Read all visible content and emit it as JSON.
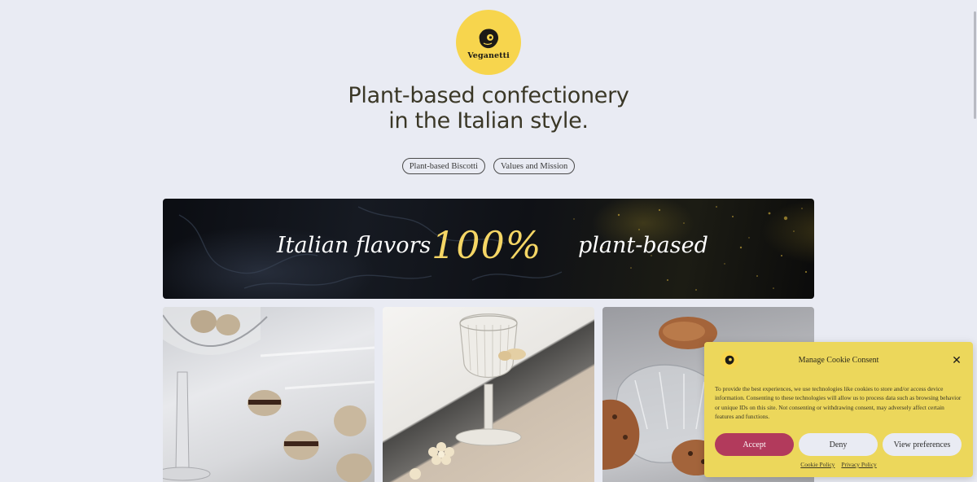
{
  "brand": {
    "name": "Veganetti",
    "accent": "#f7d54d"
  },
  "hero": {
    "headline_line1": "Plant-based confectionery",
    "headline_line2": "in the Italian style."
  },
  "nav": {
    "pills": [
      {
        "label": "Plant-based Biscotti"
      },
      {
        "label": "Values and Mission"
      }
    ]
  },
  "banner": {
    "left_text": "Italian flavors",
    "center_text": "100%",
    "right_text": "plant-based",
    "highlight_color": "#f5d665"
  },
  "gallery": {
    "photos": [
      {
        "name": "baci-biscotti-glass"
      },
      {
        "name": "ribbed-glass-cookies"
      },
      {
        "name": "biscotti-glass-dish"
      }
    ]
  },
  "cookie_banner": {
    "title": "Manage Cookie Consent",
    "close_icon": "close-icon",
    "body": "To provide the best experiences, we use technologies like cookies to store and/or access device information. Consenting to these technologies will allow us to process data such as browsing behavior or unique IDs on this site. Not consenting or withdrawing consent, may adversely affect certain features and functions.",
    "accept_label": "Accept",
    "deny_label": "Deny",
    "preferences_label": "View preferences",
    "links": [
      "Cookie Policy",
      "Privacy Policy"
    ],
    "accept_color": "#b23a5c",
    "background_color": "#ecd75b"
  }
}
